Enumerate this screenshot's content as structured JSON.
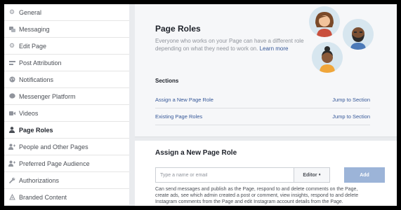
{
  "sidebar": {
    "items": [
      {
        "label": "General",
        "icon": "gear-icon"
      },
      {
        "label": "Messaging",
        "icon": "messaging-icon"
      },
      {
        "label": "Edit Page",
        "icon": "gear-icon"
      },
      {
        "label": "Post Attribution",
        "icon": "flag-icon"
      },
      {
        "label": "Notifications",
        "icon": "globe-icon"
      },
      {
        "label": "Messenger Platform",
        "icon": "messenger-icon"
      },
      {
        "label": "Videos",
        "icon": "video-icon"
      },
      {
        "label": "Page Roles",
        "icon": "person-icon",
        "active": true
      },
      {
        "label": "People and Other Pages",
        "icon": "people-icon"
      },
      {
        "label": "Preferred Page Audience",
        "icon": "people-icon"
      },
      {
        "label": "Authorizations",
        "icon": "wrench-icon"
      },
      {
        "label": "Branded Content",
        "icon": "branded-content-icon"
      }
    ]
  },
  "page_roles": {
    "title": "Page Roles",
    "description": "Everyone who works on your Page can have a different role depending on what they need to work on.",
    "learn_more": "Learn more",
    "sections_title": "Sections",
    "sections": [
      {
        "name": "Assign a New Page Role",
        "jump": "Jump to Section"
      },
      {
        "name": "Existing Page Roles",
        "jump": "Jump to Section"
      }
    ]
  },
  "assign": {
    "title": "Assign a New Page Role",
    "input_placeholder": "Type a name or email",
    "role_value": "Editor",
    "add_label": "Add",
    "helper_text": "Can send messages and publish as the Page, respond to and delete comments on the Page, create ads, see which admin created a post or comment, view insights, respond to and delete Instagram comments from the Page and edit Instagram account details from the Page."
  },
  "colors": {
    "link": "#365899",
    "button_disabled": "#9cb4d8",
    "panel_gray": "#f6f7f9"
  }
}
